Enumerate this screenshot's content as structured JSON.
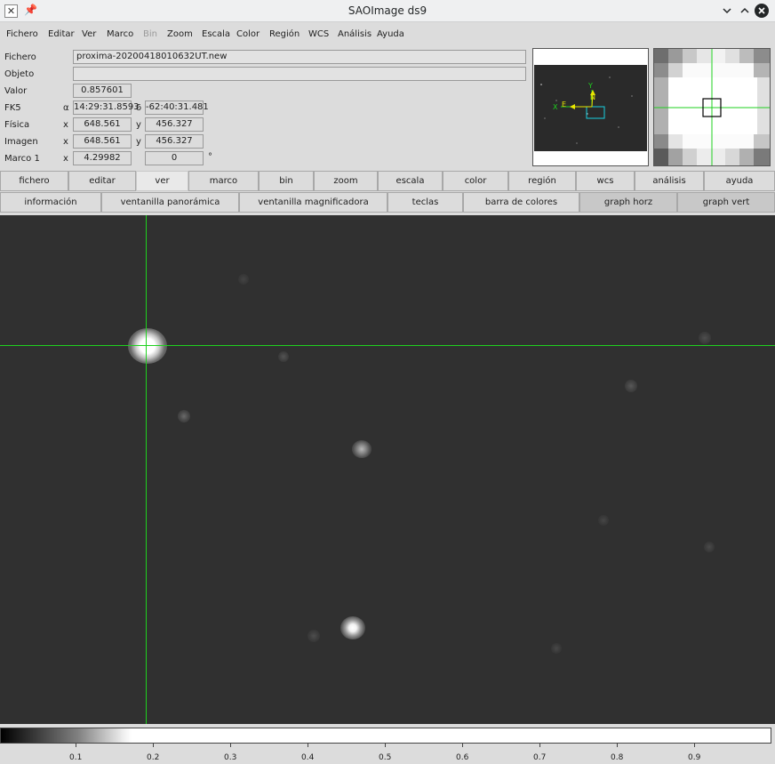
{
  "window": {
    "title": "SAOImage ds9",
    "app_icon": "x-logo-icon",
    "pin_icon": "pin-icon",
    "minimize_icon": "chevron-down-icon",
    "maximize_icon": "chevron-up-icon",
    "close_icon": "close-icon"
  },
  "menubar": [
    {
      "label": "Fichero",
      "enabled": true
    },
    {
      "label": "Editar",
      "enabled": true
    },
    {
      "label": "Ver",
      "enabled": true
    },
    {
      "label": "Marco",
      "enabled": true
    },
    {
      "label": "Bin",
      "enabled": false
    },
    {
      "label": "Zoom",
      "enabled": true
    },
    {
      "label": "Escala",
      "enabled": true
    },
    {
      "label": "Color",
      "enabled": true
    },
    {
      "label": "Región",
      "enabled": true
    },
    {
      "label": "WCS",
      "enabled": true
    },
    {
      "label": "Análisis",
      "enabled": true
    },
    {
      "label": "Ayuda",
      "enabled": true
    }
  ],
  "info": {
    "file_label": "Fichero",
    "file_value": "proxima-20200418010632UT.new",
    "object_label": "Objeto",
    "object_value": "",
    "value_label": "Valor",
    "value_value": "0.857601",
    "fk5_label": "FK5",
    "fk5_alpha_sym": "α",
    "fk5_alpha": "14:29:31.8593",
    "fk5_delta_sym": "δ",
    "fk5_delta": "-62:40:31.481",
    "physical_label": "Física",
    "physical_x_sym": "x",
    "physical_x": "648.561",
    "physical_y_sym": "y",
    "physical_y": "456.327",
    "image_label": "Imagen",
    "image_x_sym": "x",
    "image_x": "648.561",
    "image_y_sym": "y",
    "image_y": "456.327",
    "frame_label": "Marco 1",
    "frame_x_sym": "x",
    "frame_x": "4.29982",
    "frame_angle": "0",
    "frame_degree": "°"
  },
  "panner": {
    "compass_y": "Y",
    "compass_n": "N",
    "compass_x": "X",
    "compass_e": "E"
  },
  "buttonbar_main": [
    "fichero",
    "editar",
    "ver",
    "marco",
    "bin",
    "zoom",
    "escala",
    "color",
    "región",
    "wcs",
    "análisis",
    "ayuda"
  ],
  "buttonbar_main_active": "ver",
  "buttonbar_view": [
    "información",
    "ventanilla panorámica",
    "ventanilla magnificadora",
    "teclas",
    "barra de colores",
    "graph horz",
    "graph vert"
  ],
  "colors": {
    "crosshair": "#1fd11f",
    "panner_box": "#18d0e0",
    "compass_wcs": "#e8e800",
    "compass_image": "#1fd11f",
    "image_background": "#303030"
  },
  "colorbar": {
    "ticks": [
      "0.1",
      "0.2",
      "0.3",
      "0.4",
      "0.5",
      "0.6",
      "0.7",
      "0.8",
      "0.9"
    ]
  }
}
